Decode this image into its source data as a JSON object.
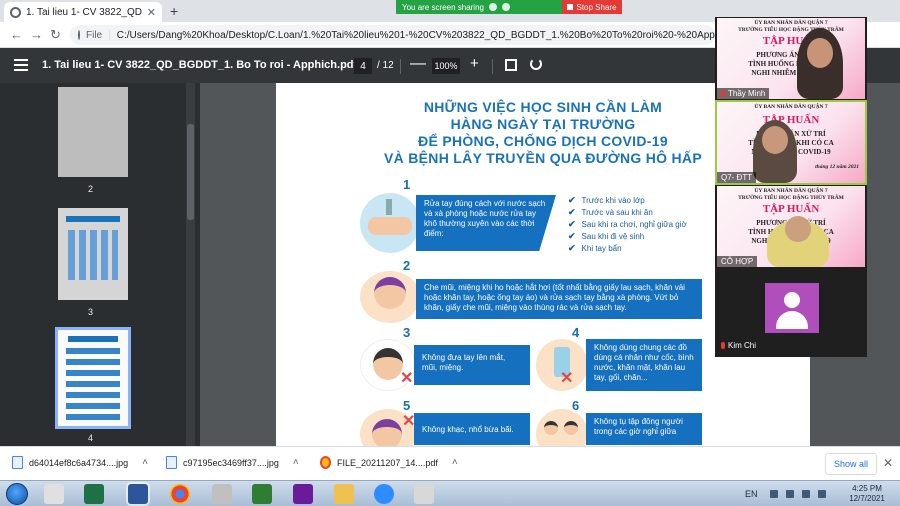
{
  "browser": {
    "tab_title": "1. Tai lieu 1- CV 3822_QD_BGDDT_1. Bo To roi - Apphich.pdf",
    "tab_close": "✕",
    "new_tab": "+",
    "share_banner": "You are screen sharing",
    "stop_share": "Stop Share",
    "back": "←",
    "forward": "→",
    "reload": "↻",
    "url_scheme": "File",
    "url": "C:/Users/Dang%20Khoa/Desktop/C.Loan/1.%20Tai%20lieu%201-%20CV%203822_QD_BGDDT_1.%20Bo%20To%20roi%20-%20Apphich.pdf"
  },
  "pdf_toolbar": {
    "title": "1. Tai lieu 1- CV 3822_QD_BGDDT_1. Bo To roi - Apphich.pdf",
    "page_current": "4",
    "page_total": "/ 12",
    "zoom_out": "—",
    "zoom": "100%",
    "zoom_in": "+"
  },
  "sidebar": {
    "thumbnails": [
      {
        "label": "2"
      },
      {
        "label": "3"
      },
      {
        "label": "4"
      }
    ]
  },
  "poster": {
    "headline": [
      "NHỮNG VIỆC HỌC SINH CẦN LÀM",
      "HÀNG NGÀY TẠI TRƯỜNG",
      "ĐỂ PHÒNG, CHỐNG DỊCH COVID-19",
      "VÀ BỆNH LÂY TRUYỀN QUA ĐƯỜNG HÔ HẤP"
    ],
    "item1": {
      "number": "1",
      "text": "Rửa tay đúng cách với nước sạch và xà phòng hoặc nước rửa tay khô thường xuyên vào các thời điểm:",
      "checks": [
        "Trước khi vào lớp",
        "Trước và sau khi ăn",
        "Sau khi ra chơi, nghỉ giữa giờ",
        "Sau khi đi vệ sinh",
        "Khi tay bẩn"
      ]
    },
    "item2": {
      "number": "2",
      "text": "Che mũi, miệng khi ho hoặc hắt hơi (tốt nhất bằng giấy lau sạch, khăn vải hoặc khăn tay, hoặc ống tay áo) và rửa sạch tay bằng xà phòng. Vứt bỏ khăn, giấy che mũi, miệng vào thùng rác và rửa sạch tay."
    },
    "item3": {
      "number": "3",
      "text": "Không đưa tay lên mắt, mũi, miệng."
    },
    "item4": {
      "number": "4",
      "text": "Không dùng chung các đồ dùng cá nhân như cốc, bình nước, khăn mặt, khăn lau tay, gối, chăn..."
    },
    "item5": {
      "number": "5",
      "text": "Không khạc, nhổ bừa bãi."
    },
    "item6": {
      "number": "6",
      "text": "Không tụ tập đông người trong các giờ nghỉ giữa"
    }
  },
  "video_tiles": [
    {
      "name": "Thầy Minh",
      "poster_line1": "ỦY BAN NHÂN DÂN QUẬN 7",
      "poster_line2": "TRƯỜNG TIỂU HỌC ĐẶNG THÙY TRÂM",
      "poster_title": "TẬP HUẤN",
      "poster_sub1": "PHƯƠNG ÁN XỬ TRÍ",
      "poster_sub2": "TÌNH HUỐNG KHI CÓ CA",
      "poster_sub3": "NGHI NHIỄM COVID-19"
    },
    {
      "name": "Q7- ĐTT",
      "poster_line1": "ỦY BAN NHÂN DÂN QUẬN 7",
      "poster_title": "TẬP HUẤN",
      "poster_sub1": "PHƯƠNG ÁN XỬ TRÍ",
      "poster_sub2": "TÌNH HUỐNG KHI CÓ CA",
      "poster_sub3": "NGHI NHIỄM COVID-19",
      "poster_date": "tháng 12 năm 2021"
    },
    {
      "name": "CÔ HỢP",
      "poster_line1": "ỦY BAN NHÂN DÂN QUẬN 7",
      "poster_line2": "TRƯỜNG TIỂU HỌC ĐẶNG THÙY TRÂM",
      "poster_title": "TẬP HUẤN",
      "poster_sub1": "PHƯƠNG ÁN XỬ TRÍ",
      "poster_sub2": "TÌNH HUỐNG KHI CÓ CA",
      "poster_sub3": "NGHI NHIỄM COVID-19"
    },
    {
      "name": "Kim Chi"
    }
  ],
  "downloads": {
    "items": [
      {
        "name": "d64014ef8c6a4734....jpg"
      },
      {
        "name": "c97195ec3469ff37....jpg"
      },
      {
        "name": "FILE_20211207_14....pdf"
      }
    ],
    "chevron": "˄",
    "show_all": "Show all",
    "close": "✕"
  },
  "taskbar": {
    "language": "EN",
    "time": "4:25 PM",
    "date": "12/7/2021"
  },
  "colors": {
    "poster_blue": "#1570c0",
    "share_green": "#25a244",
    "stop_red": "#e53935",
    "active_tile": "#9ccc3d"
  }
}
